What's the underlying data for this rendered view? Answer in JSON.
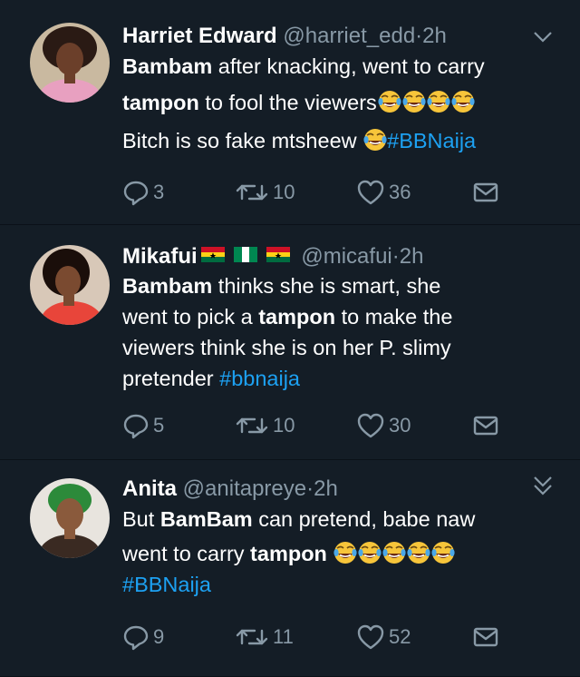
{
  "tweets": [
    {
      "name": "Harriet Edward",
      "handle": "@harriet_edd",
      "dot": "·",
      "time": "2h",
      "line1": [
        {
          "t": "Bambam",
          "b": true
        },
        {
          "t": " after knacking, went to carry"
        }
      ],
      "line2": [
        {
          "t": "tampon",
          "b": true
        },
        {
          "t": " to fool the viewers"
        }
      ],
      "line3_text": "Bitch is so fake mtsheew ",
      "hashtag": "#BBNaija",
      "replies": "3",
      "retweets": "10",
      "likes": "36"
    },
    {
      "name": "Mikafui",
      "handle": "@micafui",
      "dot": "·",
      "time": "2h",
      "line1_bold": "Bambam",
      "line1_rest": " thinks she is smart, she",
      "line2_a": "went to pick a ",
      "line2_bold": "tampon",
      "line2_rest": " to make the",
      "line3": "viewers think she is on her P. slimy",
      "line4_text": "pretender ",
      "hashtag": "#bbnaija",
      "replies": "5",
      "retweets": "10",
      "likes": "30"
    },
    {
      "name": "Anita",
      "handle": "@anitapreye",
      "dot": "·",
      "time": "2h",
      "line1_a": "But ",
      "line1_bold": "BamBam",
      "line1_rest": " can pretend, babe naw",
      "line2_a": "went to carry ",
      "line2_bold": "tampon",
      "hashtag": "#BBNaija",
      "replies": "9",
      "retweets": "11",
      "likes": "52"
    }
  ],
  "colors": {
    "background": "#141d26",
    "secondary_text": "#8899a6",
    "link": "#1da1f2"
  }
}
